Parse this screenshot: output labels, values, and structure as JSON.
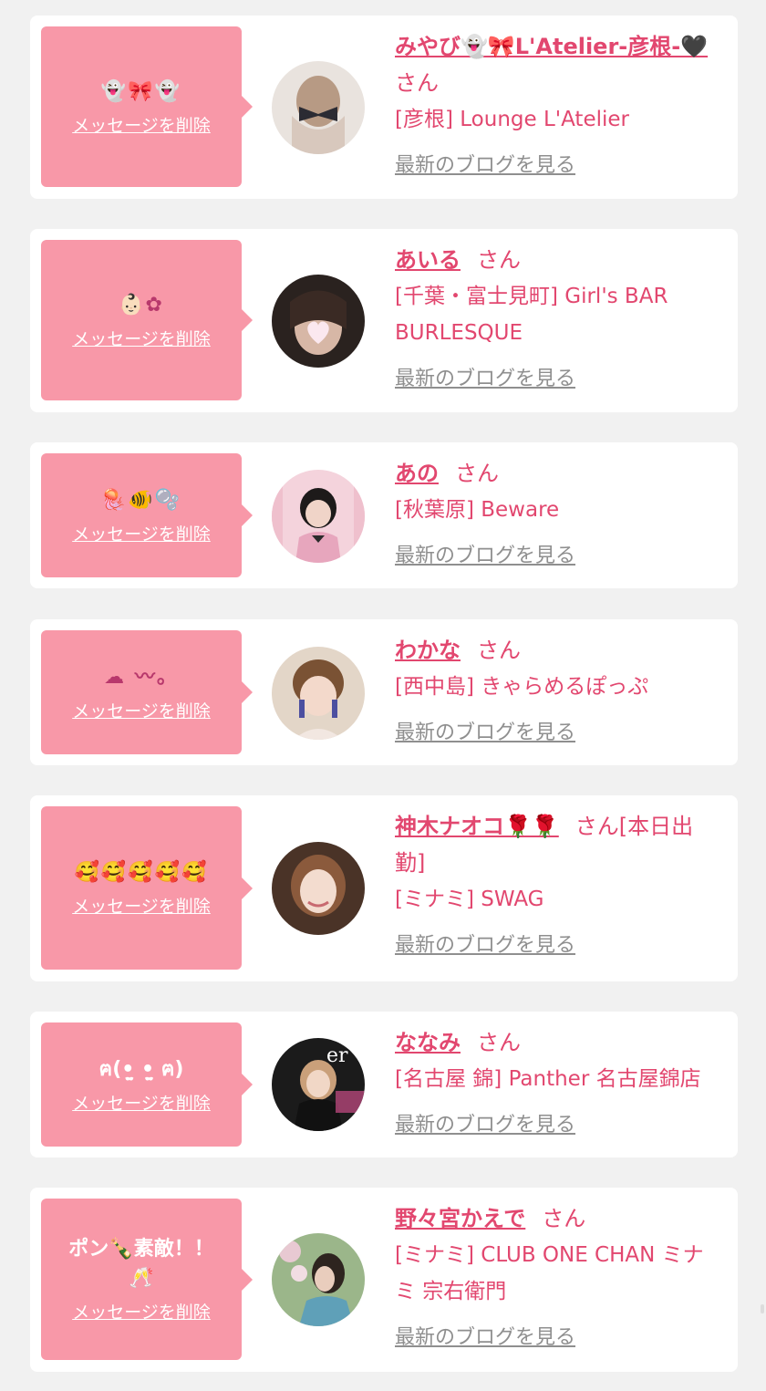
{
  "delete_label": "メッセージを削除",
  "blog_label": "最新のブログを見る",
  "san_label": "さん",
  "accent_color": "#e2476f",
  "message_bg": "#f898a8",
  "cards": [
    {
      "message": "👻🎀👻",
      "name": "みやび👻🎀L'Atelier-彦根-🖤",
      "suffix": "さん",
      "shop": "[彦根] Lounge L'Atelier"
    },
    {
      "message": "👶🏻✿",
      "name": "あいる",
      "suffix": "さん",
      "shop": "[千葉・富士見町] Girl's BAR BURLESQUE"
    },
    {
      "message": "🪼🐠🫧",
      "name": "あの",
      "suffix": "さん",
      "shop": "[秋葉原] Beware"
    },
    {
      "message": "☁︎ 〰。",
      "name": "わかな",
      "suffix": "さん",
      "shop": "[西中島] きゃらめるぽっぷ"
    },
    {
      "message": "🥰🥰🥰🥰🥰",
      "name": "神木ナオコ🌹🌹",
      "suffix": "さん[本日出勤]",
      "shop": "[ミナミ] SWAG"
    },
    {
      "message": "ฅ(•̤̫ •̤̫ ฅ)",
      "name": "ななみ",
      "suffix": "さん",
      "shop": "[名古屋 錦] Panther 名古屋錦店"
    },
    {
      "message": "ポン🍾素敵！！\n🥂",
      "name": "野々宮かえで",
      "suffix": "さん",
      "shop": "[ミナミ] CLUB ONE CHAN ミナミ 宗右衛門"
    }
  ]
}
